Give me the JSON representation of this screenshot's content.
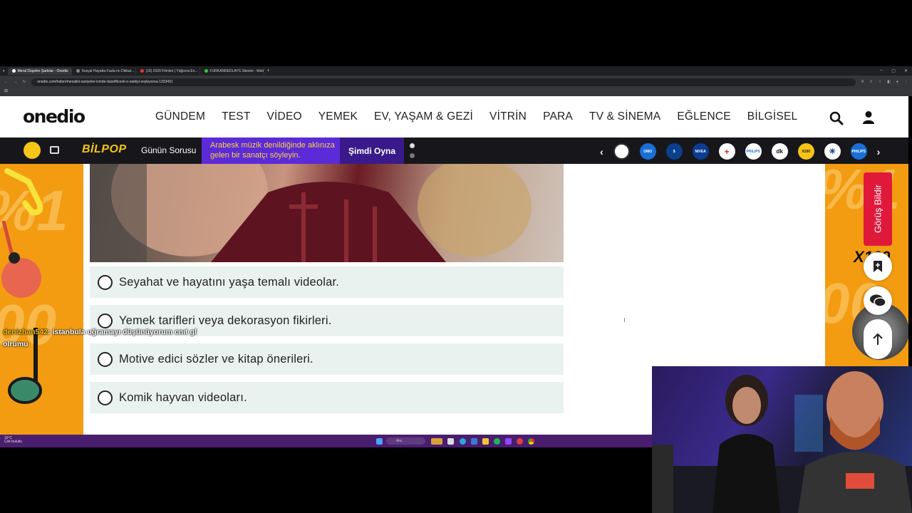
{
  "browser": {
    "tabs": [
      {
        "title": "Meral Düşelim Şarkılar - Onedio",
        "fav": "#ffffff",
        "active": true
      },
      {
        "title": "Sosyal Hayatta Fazla mı Dikkat...",
        "fav": "#e33",
        "active": false
      },
      {
        "title": "(16) 2020 Filmleri | Yüğsora En...",
        "fav": "#e33",
        "active": false
      },
      {
        "title": "FURKANREDLAYS Sitesini - Web",
        "fav": "#3c3",
        "active": false
      }
    ],
    "new_tab": "+",
    "url": "onedio.com/haber/mesalini-saniyeler-icinde-duoofticook-o-sarkiyi-soyluyorsa-1333431"
  },
  "header": {
    "logo": "onedio",
    "nav": [
      "GÜNDEM",
      "TEST",
      "VİDEO",
      "YEMEK",
      "EV, YAŞAM & GEZİ",
      "VİTRİN",
      "PARA",
      "TV & SİNEMA",
      "EĞLENCE",
      "BİLGİSEL"
    ],
    "icons": {
      "search": "search-icon",
      "user": "user-icon"
    }
  },
  "promo": {
    "brand": "BİLPOP",
    "daily_label": "Günün Sorusu",
    "question": "Arabesk müzik denildiğinde aklınıza gelen bir sanatçı söyleyin.",
    "play_label": "Şimdi Oyna",
    "brands": [
      {
        "name": "bosch",
        "color": "#ffffff"
      },
      {
        "name": "omo",
        "color": "#1a6fd6"
      },
      {
        "name": "isbank",
        "color": "#0a3f8c"
      },
      {
        "name": "nivea",
        "color": "#0b3d91"
      },
      {
        "name": "eczacibasi",
        "color": "#ffffff"
      },
      {
        "name": "philips",
        "color": "#1a6fd6"
      },
      {
        "name": "dk",
        "color": "#ffffff"
      },
      {
        "name": "x100",
        "color": "#f5c518"
      },
      {
        "name": "british",
        "color": "#ffffff"
      },
      {
        "name": "philips2",
        "color": "#1a6fd6"
      }
    ]
  },
  "quiz": {
    "options": [
      "Seyahat ve hayatını yaşa temalı videolar.",
      "Yemek tarifleri veya dekorasyon fikirleri.",
      "Motive edici sözler ve kitap önerileri.",
      "Komik hayvan videoları."
    ]
  },
  "side": {
    "feedback": "Görüş Bildir"
  },
  "chat": {
    "user": "denizhan542",
    "message": ": istanbula uğramayı düşünüyorum cnıt gl",
    "line2": "olrumu"
  },
  "taskbar": {
    "search": "Ara",
    "weather_temp": "16°C",
    "weather_desc": "Çok bulutlu"
  }
}
